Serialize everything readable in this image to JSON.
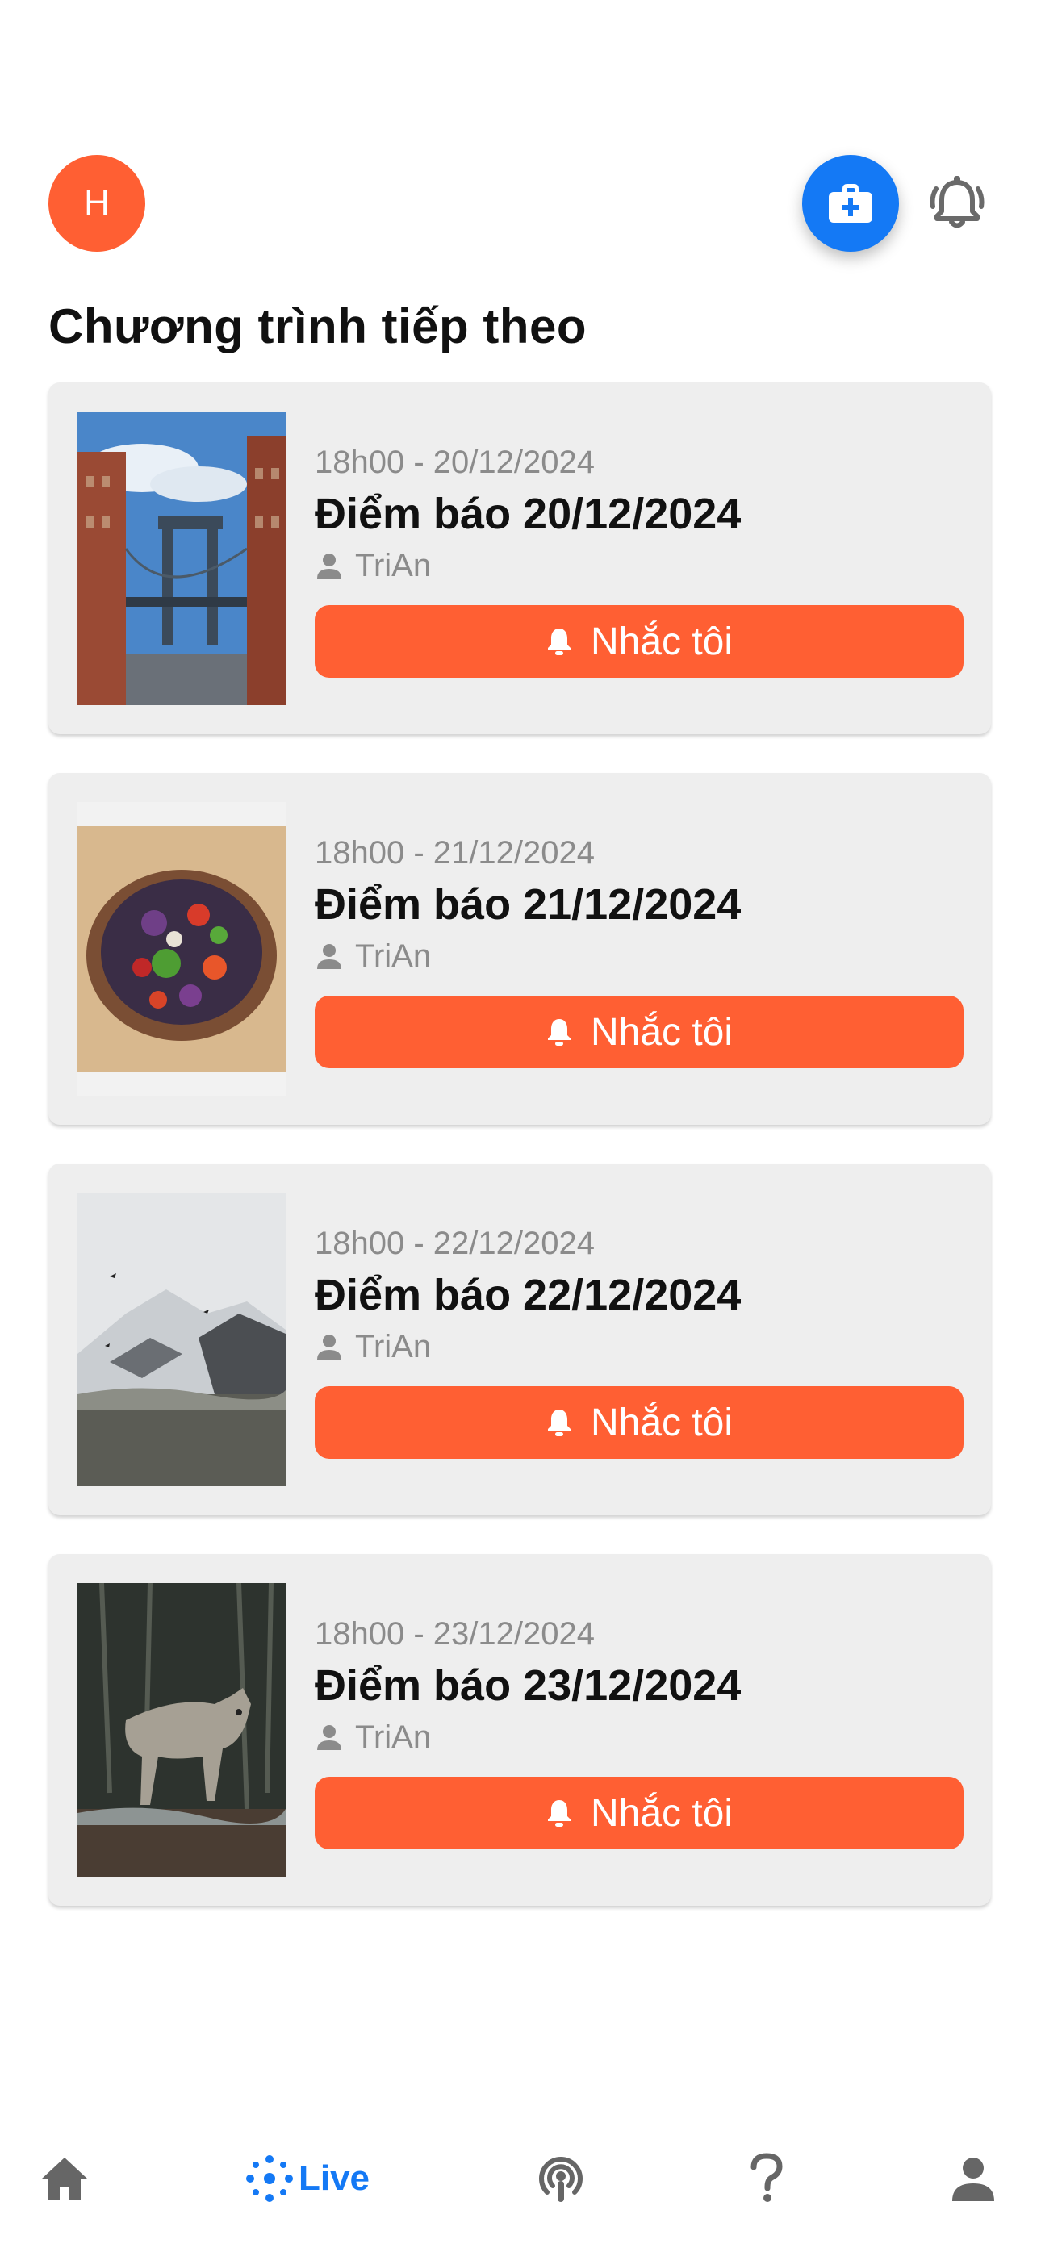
{
  "header": {
    "avatar_initial": "H",
    "create_icon": "briefcase-plus-icon",
    "notification_icon": "bell-outline-icon"
  },
  "page_title": "Chương trình tiếp theo",
  "programs": [
    {
      "time": "18h00 - 20/12/2024",
      "title": "Điểm báo 20/12/2024",
      "author": "TriAn",
      "remind_label": "Nhắc tôi",
      "thumbnail": "bridge-city-photo"
    },
    {
      "time": "18h00 - 21/12/2024",
      "title": "Điểm báo 21/12/2024",
      "author": "TriAn",
      "remind_label": "Nhắc tôi",
      "thumbnail": "salad-bowl-photo"
    },
    {
      "time": "18h00 - 22/12/2024",
      "title": "Điểm báo 22/12/2024",
      "author": "TriAn",
      "remind_label": "Nhắc tôi",
      "thumbnail": "snowy-mountain-photo"
    },
    {
      "time": "18h00 - 23/12/2024",
      "title": "Điểm báo 23/12/2024",
      "author": "TriAn",
      "remind_label": "Nhắc tôi",
      "thumbnail": "coyote-forest-photo"
    }
  ],
  "tabbar": {
    "home_icon": "home-icon",
    "live_label": "Live",
    "podcast_icon": "podcast-icon",
    "help_icon": "question-icon",
    "profile_icon": "person-icon",
    "active_color": "#1479F5",
    "inactive_color": "#666666"
  },
  "colors": {
    "accent": "#FF5F33",
    "primary": "#1479F5",
    "card_bg": "#EEEEEE"
  }
}
